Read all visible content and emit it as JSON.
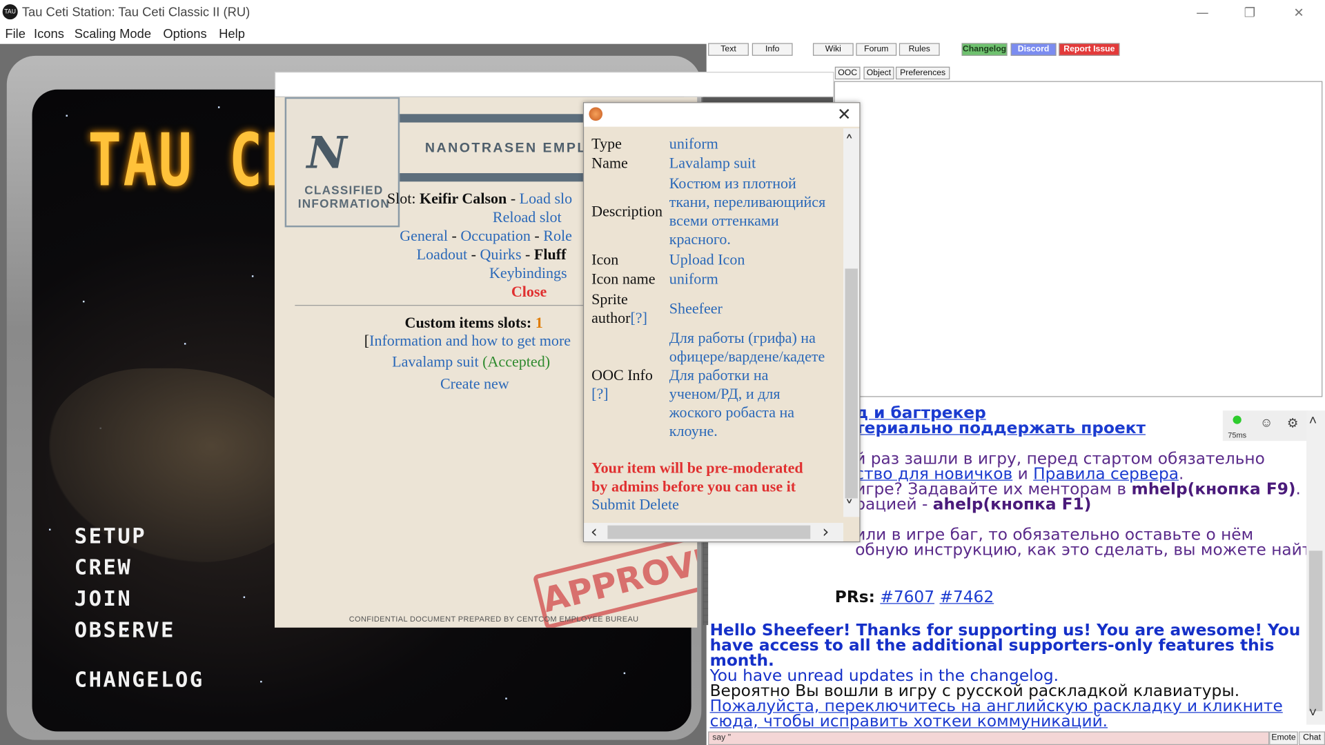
{
  "window": {
    "icon_text": "TAU",
    "title": "Tau Ceti Station: Tau Ceti Classic II (RU)",
    "minimize": "—",
    "restore": "❐",
    "close": "✕"
  },
  "menu": [
    "File",
    "Icons",
    "Scaling Mode",
    "Options",
    "Help"
  ],
  "game": {
    "title": "TAU CETI",
    "menu_items": [
      "SETUP",
      "CREW",
      "JOIN",
      "OBSERVE",
      "CHANGELOG"
    ]
  },
  "dossier": {
    "logo_letter": "N",
    "classified": "CLASSIFIED INFORMATION",
    "banner": "NANOTRASEN EMPLO",
    "slot_label": "Slot:",
    "slot_name": "Keifir Calson",
    "dash": "-",
    "load_slot": "Load slo",
    "reload_slot": "Reload slot",
    "nav_row1": [
      "General",
      "Occupation",
      "Role"
    ],
    "nav_row2": [
      "Loadout",
      "Quirks"
    ],
    "fluff": "Fluff",
    "keybindings": "Keybindings",
    "close": "Close",
    "custom_slots_label": "Custom items slots:",
    "custom_slots_count": "1",
    "info_bracket": "[",
    "info_link": "Information and how to get more",
    "item_name": "Lavalamp suit",
    "item_status": "(Accepted)",
    "create_new": "Create new",
    "stamp": "APPROVED",
    "footer": "CONFIDENTIAL DOCUMENT PREPARED BY CENTCOM EMPLOYEE BUREAU"
  },
  "popup": {
    "close": "✕",
    "type_label": "Type",
    "type_value": "uniform",
    "name_label": "Name",
    "name_value": "Lavalamp suit",
    "desc_label": "Description",
    "desc_lines": [
      "Костюм из плотной",
      "ткани, переливающийся",
      "всеми оттенками",
      "красного."
    ],
    "icon_label": "Icon",
    "icon_value": "Upload Icon",
    "icon_name_label": "Icon name",
    "icon_name_value": "uniform",
    "sprite_label_1": "Sprite",
    "sprite_label_2": "author",
    "help_link": "[?]",
    "sprite_value": "Sheefeer",
    "ooc_label": "OOC Info",
    "ooc_lines": [
      "Для работы (грифа) на",
      "офицере/вардене/кадете",
      "Для работки на",
      "ученом/РД, и для",
      "жоского робаста на",
      "клоуне."
    ],
    "warning_1": "Your item will be pre-moderated",
    "warning_2": "by admins before you can use it",
    "submit": "Submit",
    "delete": "Delete",
    "arrow_up": "˄",
    "arrow_down": "˅",
    "arrow_left": "‹",
    "arrow_right": "›"
  },
  "right_tabs": [
    "Text",
    "Info",
    "Wiki",
    "Forum",
    "Rules",
    "Changelog",
    "Discord",
    "Report Issue"
  ],
  "stat_tabs": [
    "OOC",
    "Object",
    "Preferences"
  ],
  "chat": {
    "ping": "75ms",
    "smile_icon": "☺",
    "gear_icon": "⚙",
    "line1": "д и багтрекер",
    "line2": "териально поддержать проект",
    "line3": "й раз зашли в игру, перед стартом обязательно",
    "line4a": "ство для новичков",
    "line4b": " и ",
    "line4c": "Правила сервера",
    "line4d": ".",
    "line5a": "игре? Задавайте их менторам в ",
    "line5b": "mhelp(кнопка F9)",
    "line5c": ".",
    "line6a": "рацией - ",
    "line6b": "ahelp(кнопка F1)",
    "line7": "или в игре баг, то обязательно оставьте о нём",
    "line8": "обную инструкцию, как это сделать, вы можете найти",
    "pr_label": "PRs:",
    "pr1": "#7607",
    "pr2": "#7462",
    "hello1": "Hello Sheefeer! Thanks for supporting us! You are awesome! You",
    "hello2": "have access to all the additional supporters-only features this",
    "hello3": "month.",
    "unread": "You have unread updates in the changelog.",
    "layout1": "Вероятно Вы вошли в игру с русской раскладкой клавиатуры.",
    "layout2": "Пожалуйста, переключитесь на английскую раскладку и кликните",
    "layout3": "сюда, чтобы исправить хоткеи коммуникаций.",
    "scroll_up": "˄",
    "scroll_down": "˅"
  },
  "input": {
    "value": "say \"",
    "emote": "Emote",
    "chat": "Chat"
  }
}
